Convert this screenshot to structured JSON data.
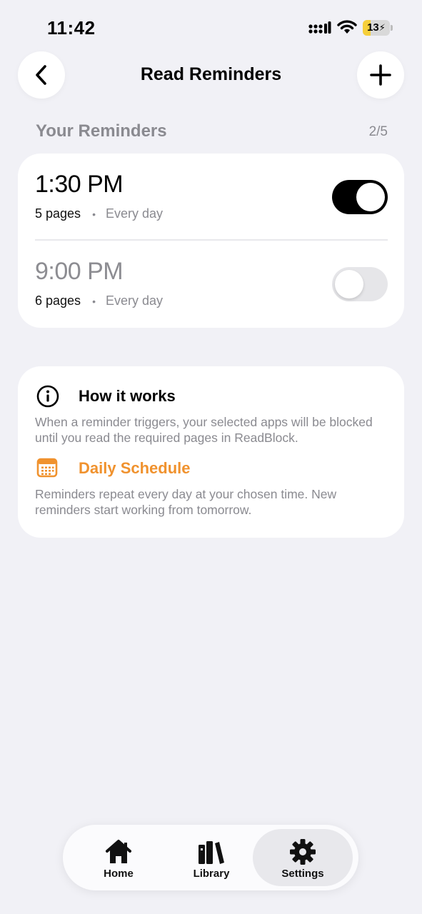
{
  "status_bar": {
    "time": "11:42",
    "battery": "13",
    "battery_level": 0.13
  },
  "header": {
    "title": "Read Reminders",
    "icons": {
      "back": "chevron-left-icon",
      "add": "plus-icon"
    }
  },
  "section": {
    "title": "Your Reminders",
    "count": "2/5"
  },
  "reminders": [
    {
      "time": "1:30 PM",
      "pages": "5 pages",
      "dot": "•",
      "frequency": "Every day",
      "enabled": true
    },
    {
      "time": "9:00 PM",
      "pages": "6 pages",
      "dot": "•",
      "frequency": "Every day",
      "enabled": false
    }
  ],
  "info": {
    "how_title": "How it works",
    "how_text": "When a reminder triggers, your selected apps will be blocked until you read the required pages in ReadBlock.",
    "schedule_title": "Daily Schedule",
    "schedule_text": "Reminders repeat every day at your chosen time. New reminders start working from tomorrow.",
    "accent_color": "#f0922e",
    "icons": {
      "how": "info-circle-icon",
      "schedule": "calendar-icon"
    }
  },
  "tab_bar": {
    "active": "Settings",
    "tabs": [
      {
        "label": "Home",
        "icon": "home-icon"
      },
      {
        "label": "Library",
        "icon": "books-icon"
      },
      {
        "label": "Settings",
        "icon": "gear-icon"
      }
    ]
  }
}
